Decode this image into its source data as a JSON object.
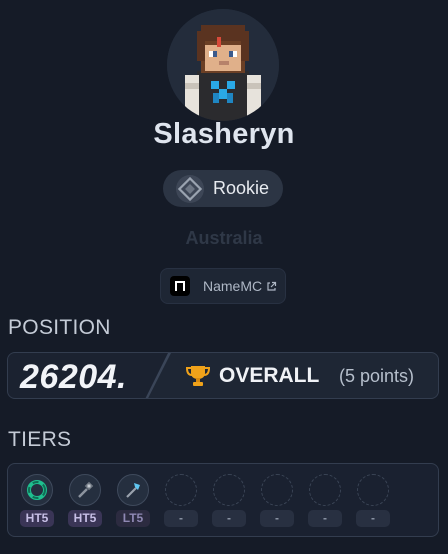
{
  "profile": {
    "name": "Slasheryn",
    "rank": "Rookie",
    "region": "Australia",
    "namemc_label": "NameMC"
  },
  "position": {
    "section_title": "POSITION",
    "rank_number": "26204.",
    "overall_label": "OVERALL",
    "points_text": "(5 points)"
  },
  "tiers": {
    "section_title": "TIERS",
    "items": [
      {
        "icon": "ring-icon",
        "label": "HT5"
      },
      {
        "icon": "mace-icon",
        "label": "HT5"
      },
      {
        "icon": "axe-icon",
        "label": "LT5"
      },
      {
        "icon": "empty-slot",
        "label": "-"
      },
      {
        "icon": "empty-slot",
        "label": "-"
      },
      {
        "icon": "empty-slot",
        "label": "-"
      },
      {
        "icon": "empty-slot",
        "label": "-"
      },
      {
        "icon": "empty-slot",
        "label": "-"
      }
    ]
  },
  "colors": {
    "background": "#151b27",
    "card": "#1e2634",
    "trophy": "#f0a21a",
    "high_tier_badge": "#3a3556",
    "low_tier_badge": "#2c2b40"
  }
}
